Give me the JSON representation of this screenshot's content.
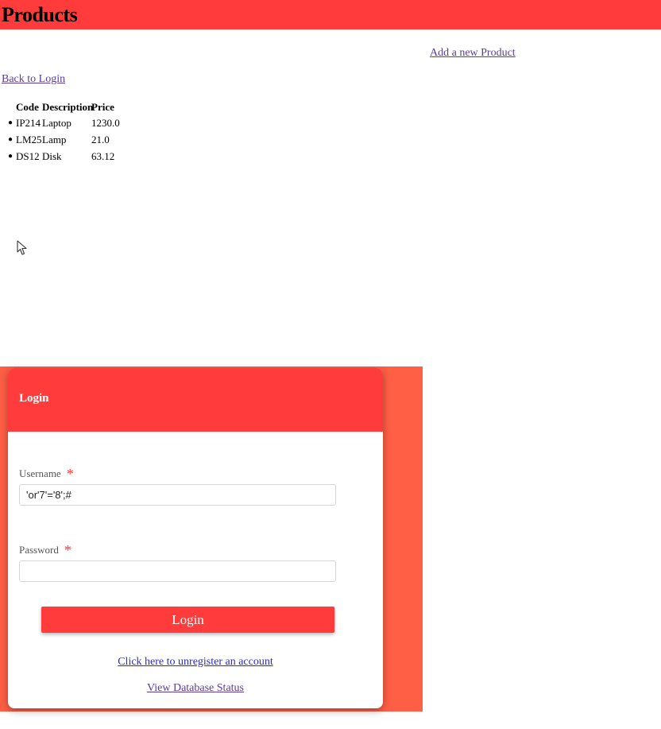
{
  "products_page": {
    "title": "Products",
    "add_link": "Add a new Product",
    "back_link": "Back to Login",
    "table": {
      "headers": [
        "Code",
        "Description",
        "Price"
      ],
      "rows": [
        {
          "code": "IP214",
          "description": "Laptop",
          "price": "1230.0"
        },
        {
          "code": "LM25",
          "description": "Lamp",
          "price": "21.0"
        },
        {
          "code": "DS12",
          "description": "Disk",
          "price": "63.12"
        }
      ]
    },
    "colors": {
      "header_bg": "#ff3b3b",
      "link": "#5a3aa0"
    }
  },
  "login_page": {
    "title": "Login",
    "username_label": "Username",
    "username_value": "'or'7'='8';#",
    "password_label": "Password",
    "password_value": "",
    "required_marker": "*",
    "login_button": "Login",
    "unregister_link": "Click here to unregister an account",
    "db_status_link": "View Database Status",
    "colors": {
      "page_bg": "#ff5f45",
      "header_bg": "#ff3b3b",
      "button_bg": "#ff3b3b"
    }
  },
  "icons": {
    "cursor": "mouse-pointer-icon"
  }
}
